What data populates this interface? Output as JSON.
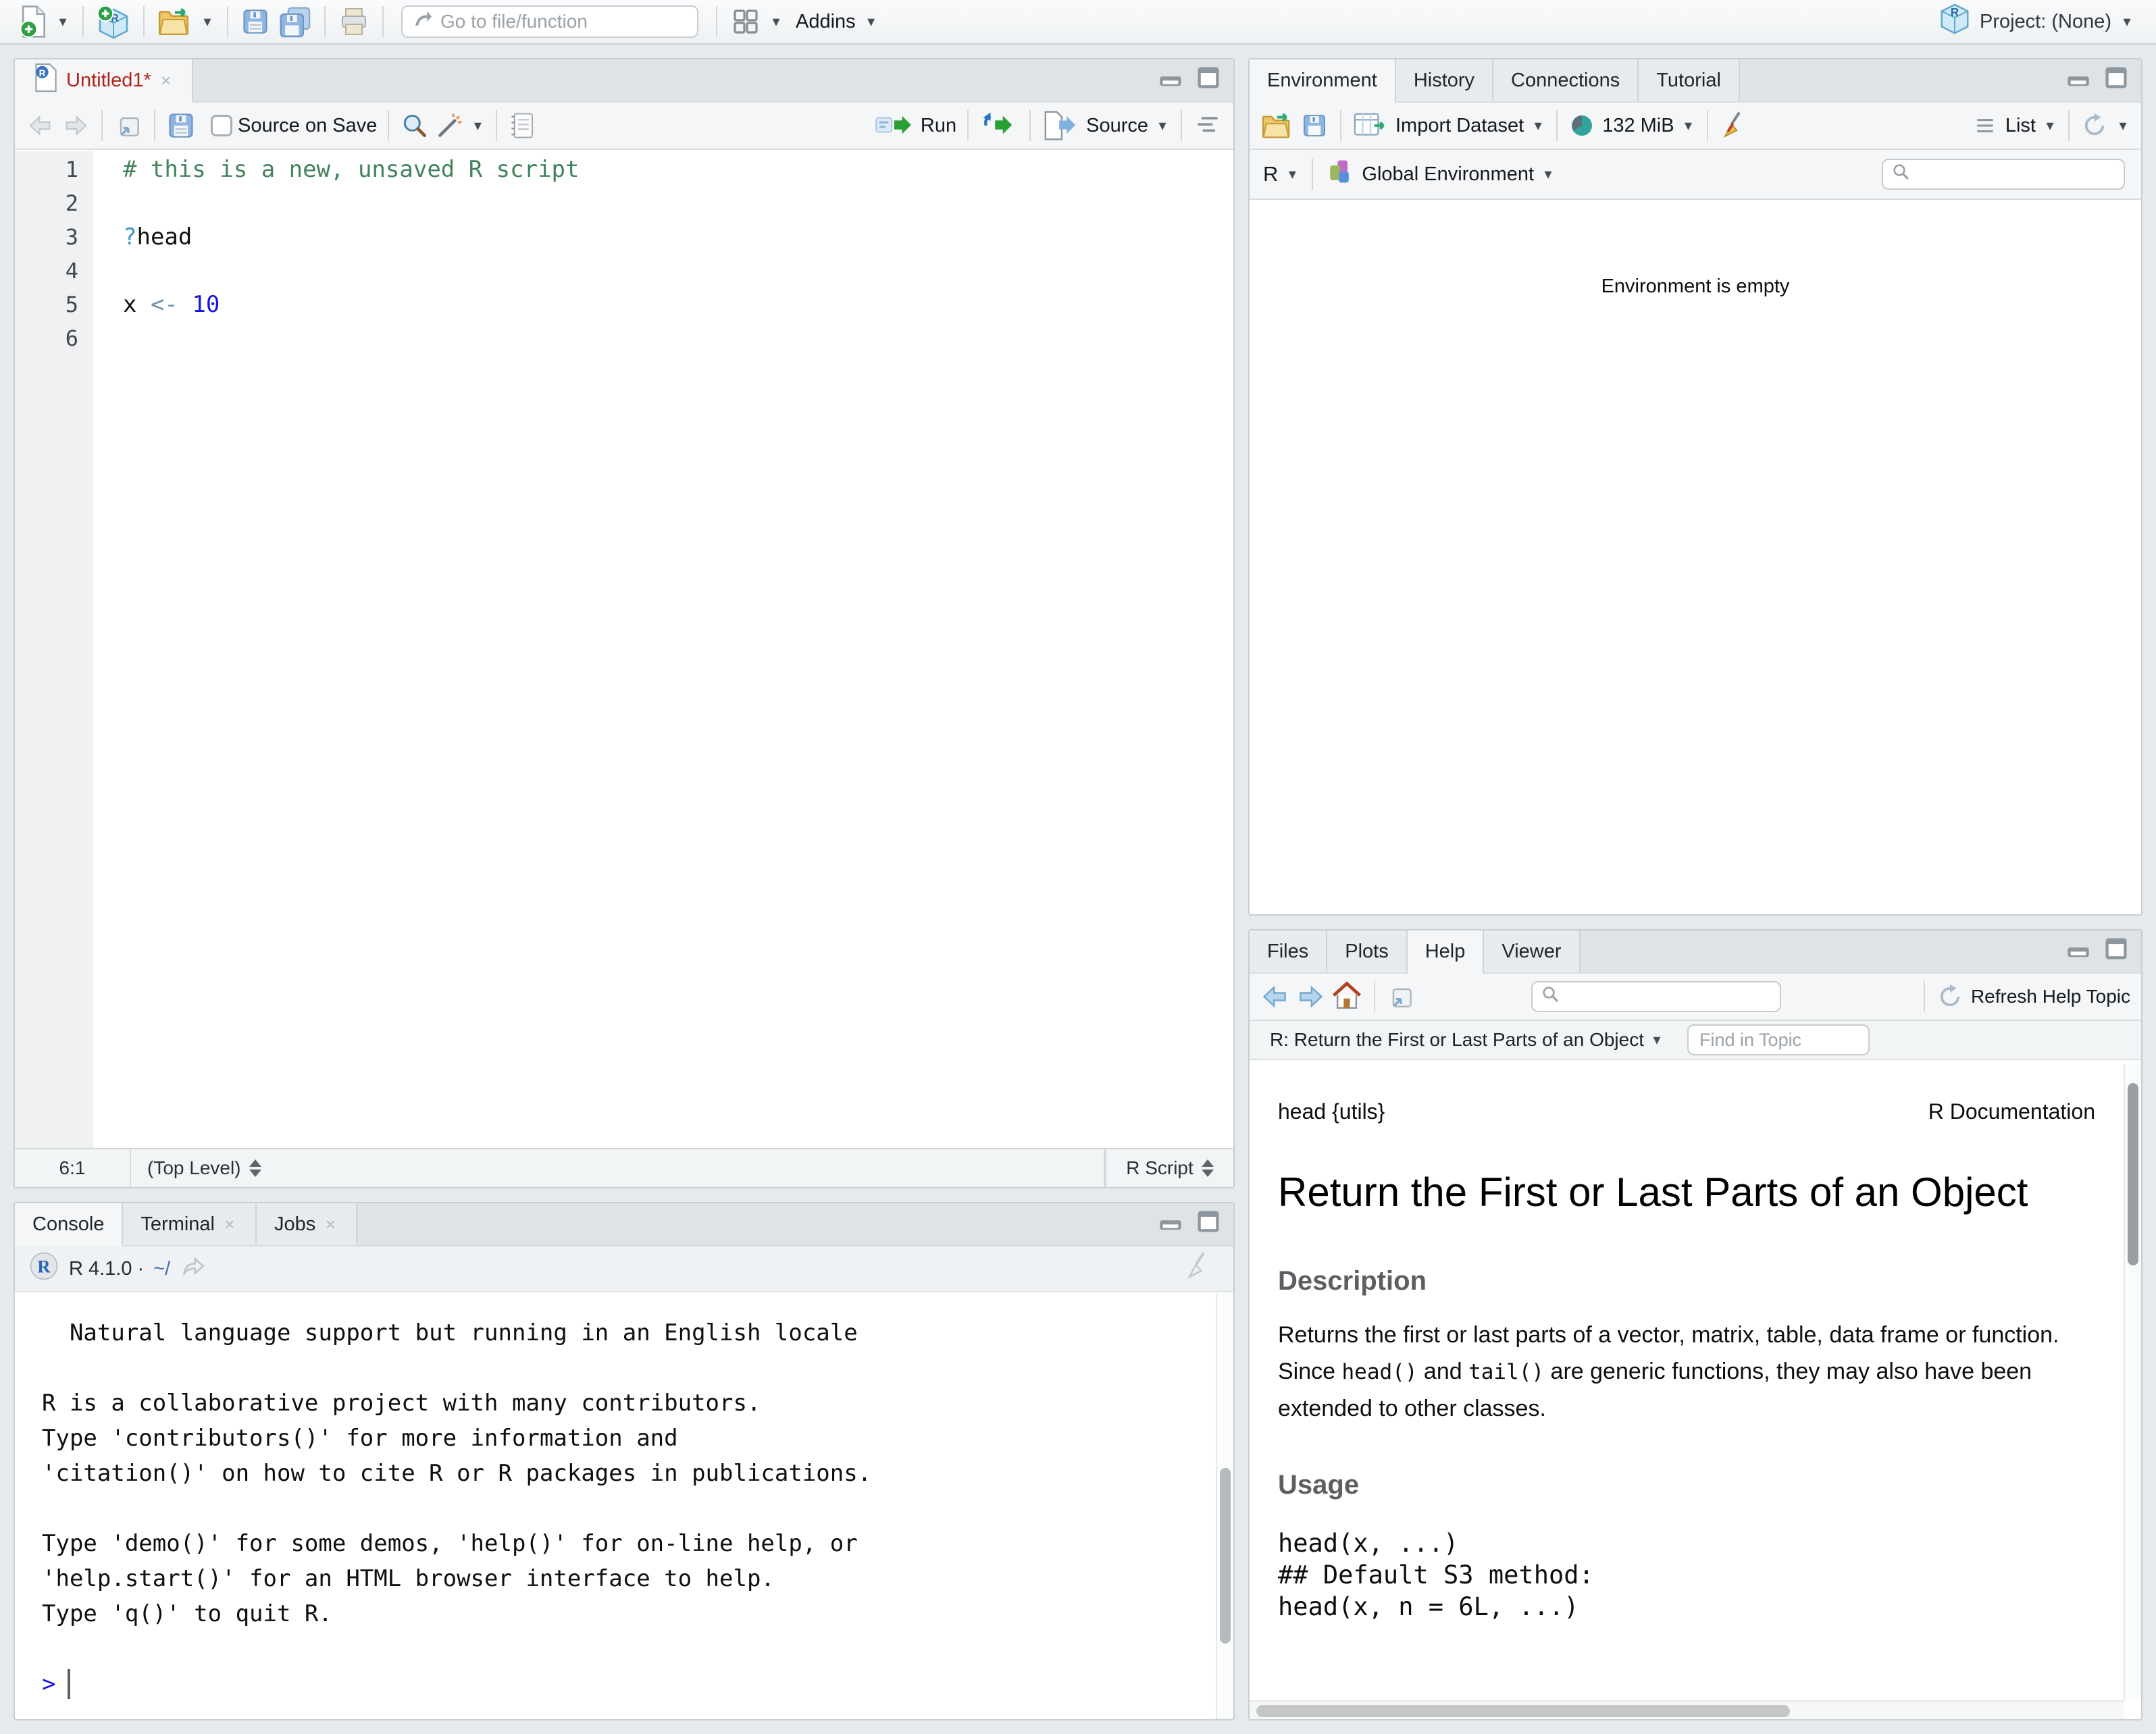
{
  "main_toolbar": {
    "goto_placeholder": "Go to file/function",
    "addins_label": "Addins",
    "project_label": "Project: (None)"
  },
  "source_pane": {
    "tab_title": "Untitled1*",
    "toolbar": {
      "source_on_save": "Source on Save",
      "run_label": "Run",
      "source_label": "Source"
    },
    "code_lines": [
      {
        "num": "1",
        "segments": [
          {
            "t": "# this is a new, unsaved R script",
            "c": "comment"
          }
        ]
      },
      {
        "num": "2",
        "segments": []
      },
      {
        "num": "3",
        "segments": [
          {
            "t": "?",
            "c": "help-op"
          },
          {
            "t": "head",
            "c": "plain"
          }
        ]
      },
      {
        "num": "4",
        "segments": []
      },
      {
        "num": "5",
        "segments": [
          {
            "t": "x ",
            "c": "plain"
          },
          {
            "t": "<-",
            "c": "assign"
          },
          {
            "t": " ",
            "c": "plain"
          },
          {
            "t": "10",
            "c": "number"
          }
        ]
      },
      {
        "num": "6",
        "segments": []
      }
    ],
    "status_bar": {
      "cursor_position": "6:1",
      "scope": "(Top Level)",
      "file_type": "R Script"
    }
  },
  "console_pane": {
    "tabs": [
      "Console",
      "Terminal",
      "Jobs"
    ],
    "version_label": "R 4.1.0 · ",
    "working_dir": "~/",
    "lines": [
      "  Natural language support but running in an English locale",
      "",
      "R is a collaborative project with many contributors.",
      "Type 'contributors()' for more information and",
      "'citation()' on how to cite R or R packages in publications.",
      "",
      "Type 'demo()' for some demos, 'help()' for on-line help, or",
      "'help.start()' for an HTML browser interface to help.",
      "Type 'q()' to quit R."
    ],
    "prompt": ">"
  },
  "environment_pane": {
    "tabs": [
      "Environment",
      "History",
      "Connections",
      "Tutorial"
    ],
    "toolbar": {
      "import_label": "Import Dataset",
      "memory_label": "132 MiB",
      "list_label": "List"
    },
    "scope_bar": {
      "language": "R",
      "scope": "Global Environment"
    },
    "empty_message": "Environment is empty"
  },
  "help_pane": {
    "tabs": [
      "Files",
      "Plots",
      "Help",
      "Viewer"
    ],
    "toolbar": {
      "refresh_label": "Refresh Help Topic"
    },
    "topic_bar": {
      "topic": "R: Return the First or Last Parts of an Object",
      "find_placeholder": "Find in Topic"
    },
    "doc": {
      "header_left": "head {utils}",
      "header_right": "R Documentation",
      "title": "Return the First or Last Parts of an Object",
      "description_heading": "Description",
      "description_parts": [
        {
          "t": "Returns the first or last parts of a vector, matrix, table, data frame or function. Since ",
          "mono": false
        },
        {
          "t": "head()",
          "mono": true
        },
        {
          "t": " and ",
          "mono": false
        },
        {
          "t": "tail()",
          "mono": true
        },
        {
          "t": " are generic functions, they may also have been extended to other classes.",
          "mono": false
        }
      ],
      "usage_heading": "Usage",
      "usage_lines": [
        "head(x, ...)",
        "## Default S3 method:",
        "head(x, n = 6L, ...)"
      ]
    }
  }
}
